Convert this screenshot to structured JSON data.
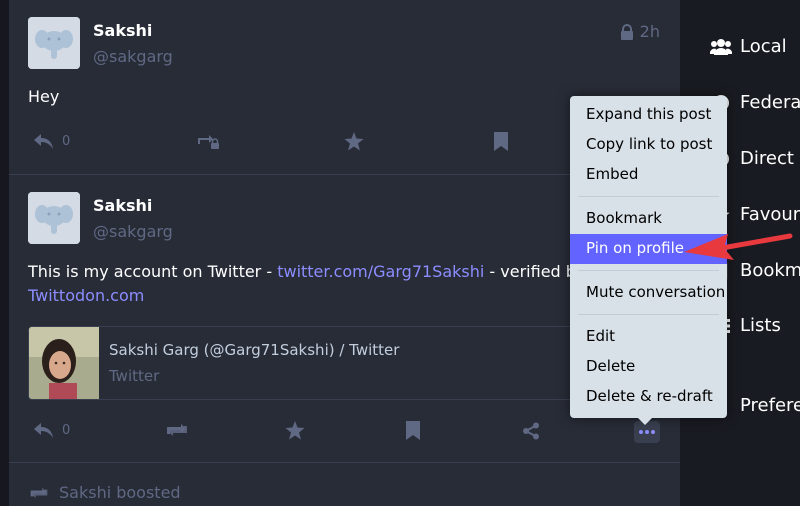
{
  "posts": [
    {
      "display_name": "Sakshi",
      "acct": "@sakgarg",
      "time": "2h",
      "content": "Hey",
      "reply_count": "0"
    },
    {
      "display_name": "Sakshi",
      "acct": "@sakgarg",
      "content_text": "This is my account on Twitter - ",
      "link1": "twitter.com/Garg71Sakshi",
      "content_text2": " - verified by (",
      "link2": "Twittodon.com",
      "reply_count": "0",
      "card": {
        "title": "Sakshi Garg (@Garg71Sakshi) / Twitter",
        "provider": "Twitter"
      }
    }
  ],
  "boosted_label": "Sakshi boosted",
  "nav": {
    "local": "Local",
    "federated": "Federat",
    "direct": "Direct m",
    "favourites": "Favouri",
    "bookmarks": "Bookma",
    "lists": "Lists",
    "preferences": "Prefere"
  },
  "menu": {
    "expand": "Expand this post",
    "copy_link": "Copy link to post",
    "embed": "Embed",
    "bookmark": "Bookmark",
    "pin": "Pin on profile",
    "mute": "Mute conversation",
    "edit": "Edit",
    "delete": "Delete",
    "redraft": "Delete & re-draft"
  },
  "colors": {
    "accent": "#6364ff",
    "link": "#8c8dff",
    "annotation_arrow": "#e8393f"
  }
}
